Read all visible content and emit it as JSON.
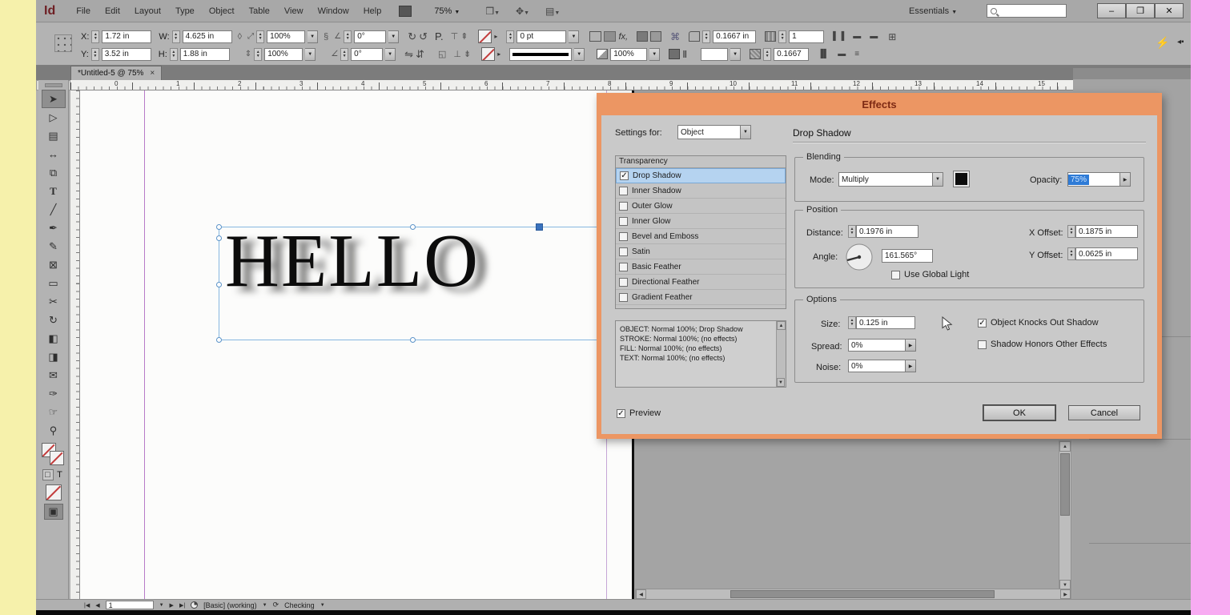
{
  "colors": {
    "dialog_accent": "#ec9663",
    "selection_blue": "#3a72bd",
    "row_highlight": "#b5d3f0",
    "text_select": "#2e7bd6",
    "left_strip": "#f6f1ab",
    "right_strip": "#f8abf2"
  },
  "titlebar": {
    "logo": "Id",
    "menus": [
      "File",
      "Edit",
      "Layout",
      "Type",
      "Object",
      "Table",
      "View",
      "Window",
      "Help"
    ],
    "zoom_level": "75%",
    "workspace": "Essentials",
    "search_value": "",
    "window_buttons": {
      "minimize": "–",
      "restore": "❐",
      "close": "✕"
    }
  },
  "control_panel": {
    "x_label": "X:",
    "x_value": "1.72 in",
    "y_label": "Y:",
    "y_value": "3.52 in",
    "w_label": "W:",
    "w_value": "4.625 in",
    "h_label": "H:",
    "h_value": "1.88 in",
    "scale_x": "100%",
    "scale_y": "100%",
    "rotation": "0°",
    "shear": "0°",
    "stroke_weight": "0 pt",
    "opacity": "100%",
    "corner_radius": "0.1667 in",
    "columns": "1",
    "gutter": "0.1667"
  },
  "doc_tab": {
    "title": "*Untitled-5 @ 75%",
    "close": "×"
  },
  "ruler": {
    "numbers": [
      "0",
      "1",
      "2",
      "3",
      "4",
      "5",
      "6",
      "7",
      "8",
      "9",
      "10",
      "11",
      "12",
      "13",
      "14",
      "15"
    ]
  },
  "toolbar": {
    "tools": [
      "➤",
      "▷",
      "▤",
      "↔",
      "⧉",
      "T",
      "╱",
      "✒",
      "✎",
      "⊠",
      "▭",
      "✂",
      "↻",
      "◧",
      "◨",
      "✉",
      "✑",
      "☞",
      "⚲"
    ],
    "container_toggle": "□",
    "text_toggle": "T",
    "screen_mode": "▣"
  },
  "canvas": {
    "text": "HELLO"
  },
  "dialog": {
    "title": "Effects",
    "settings_for_label": "Settings for:",
    "settings_for_value": "Object",
    "section_title": "Drop Shadow",
    "list_header": "Transparency",
    "effects": [
      "Drop Shadow",
      "Inner Shadow",
      "Outer Glow",
      "Inner Glow",
      "Bevel and Emboss",
      "Satin",
      "Basic Feather",
      "Directional Feather",
      "Gradient Feather"
    ],
    "summary": [
      "OBJECT: Normal 100%; Drop Shadow",
      "STROKE: Normal 100%; (no effects)",
      "FILL: Normal 100%; (no effects)",
      "TEXT: Normal 100%; (no effects)"
    ],
    "blending": {
      "label": "Blending",
      "mode_label": "Mode:",
      "mode_value": "Multiply",
      "opacity_label": "Opacity:",
      "opacity_value": "75%"
    },
    "position": {
      "label": "Position",
      "distance_label": "Distance:",
      "distance_value": "0.1976 in",
      "angle_label": "Angle:",
      "angle_value": "161.565°",
      "x_offset_label": "X Offset:",
      "x_offset_value": "0.1875 in",
      "y_offset_label": "Y Offset:",
      "y_offset_value": "0.0625 in",
      "global_light_label": "Use Global Light"
    },
    "options": {
      "label": "Options",
      "size_label": "Size:",
      "size_value": "0.125 in",
      "spread_label": "Spread:",
      "spread_value": "0%",
      "noise_label": "Noise:",
      "noise_value": "0%",
      "knockout_label": "Object Knocks Out Shadow",
      "honors_label": "Shadow Honors Other Effects"
    },
    "preview_label": "Preview",
    "ok_label": "OK",
    "cancel_label": "Cancel",
    "checkmark": "✓"
  },
  "status_bar": {
    "page_value": "1",
    "preflight_profile": "[Basic] (working)",
    "preflight_status": "Checking"
  }
}
